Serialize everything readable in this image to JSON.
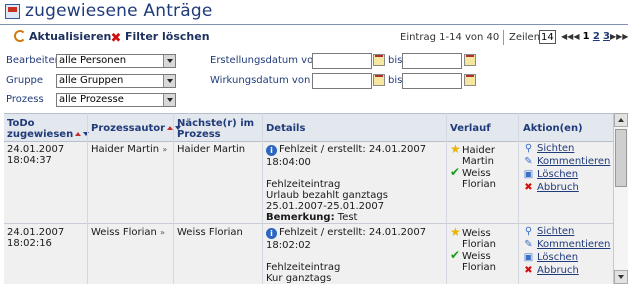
{
  "title": "zugewiesene Anträge",
  "toolbar": {
    "refresh": "Aktualisieren",
    "clear_filter": "Filter löschen",
    "entries": "Eintrag 1-14 von 40",
    "rows_label": "Zeilen",
    "rows_value": "14",
    "pager": {
      "pages": [
        "1",
        "2",
        "3"
      ],
      "current": "1"
    }
  },
  "filters": {
    "bearbeiter_label": "Bearbeiter",
    "bearbeiter_value": "alle Personen",
    "gruppe_label": "Gruppe",
    "gruppe_value": "alle Gruppen",
    "prozess_label": "Prozess",
    "prozess_value": "alle Prozesse",
    "erstellungsdatum_label": "Erstellungsdatum von",
    "wirkungsdatum_label": "Wirkungsdatum von",
    "bis_label": "bis"
  },
  "table": {
    "headers": {
      "todo": [
        "ToDo",
        "zugewiesen"
      ],
      "author": "Prozessautor",
      "next": [
        "Nächste(r) im",
        "Prozess"
      ],
      "details": "Details",
      "history": "Verlauf",
      "actions": "Aktion(en)"
    },
    "action_labels": [
      "Sichten",
      "Kommentieren",
      "Löschen",
      "Abbruch"
    ],
    "rows": [
      {
        "date": "24.01.2007",
        "time": "18:04:37",
        "author": "Haider Martin",
        "next": "Haider Martin",
        "details_head": "Fehlzeit  / erstellt: 24.01.2007",
        "details_time": "18:04:00",
        "details_lines": [
          "Fehlzeiteintrag",
          "Urlaub bezahlt ganztags",
          "25.01.2007-25.01.2007"
        ],
        "remark_label": "Bemerkung:",
        "remark_value": "Test",
        "history": [
          {
            "type": "star",
            "first": "Haider",
            "second": "Martin"
          },
          {
            "type": "check",
            "first": "Weiss",
            "second": "Florian"
          }
        ]
      },
      {
        "date": "24.01.2007",
        "time": "18:02:16",
        "author": "Weiss Florian",
        "next": "Weiss Florian",
        "details_head": "Fehlzeit  / erstellt: 24.01.2007",
        "details_time": "18:02:02",
        "details_lines": [
          "Fehlzeiteintrag",
          "Kur ganztags"
        ],
        "history": [
          {
            "type": "star",
            "first": "Weiss",
            "second": "Florian"
          },
          {
            "type": "check",
            "first": "Weiss",
            "second": "Florian"
          }
        ]
      }
    ]
  },
  "colors": {
    "accent": "#203b7a",
    "header_bg": "#e3e7ee",
    "row_bg": "#f0f0f0"
  },
  "icons": [
    "form-icon",
    "refresh-icon",
    "delete-filter-icon",
    "calendar-icon",
    "info-icon",
    "star-icon",
    "check-icon",
    "magnifier-icon",
    "comment-icon",
    "trash-icon",
    "abort-icon"
  ]
}
